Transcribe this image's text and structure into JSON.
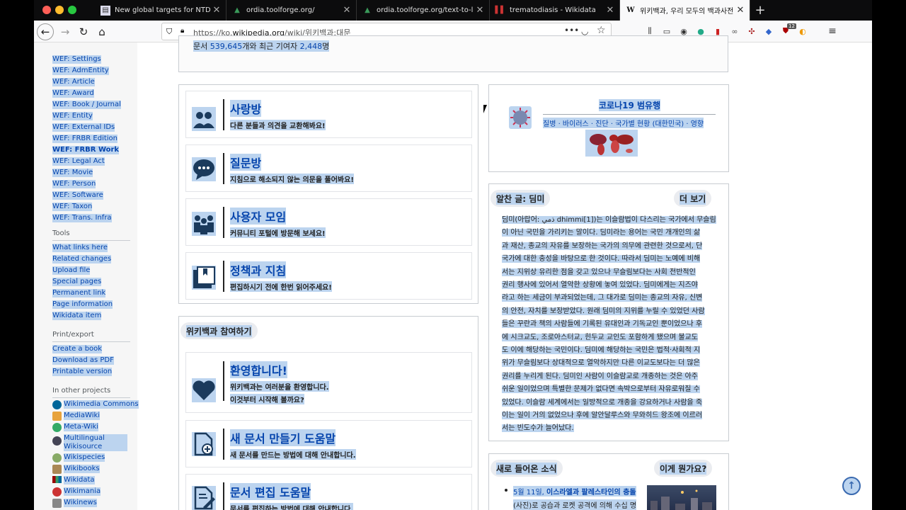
{
  "browser": {
    "tabs": [
      {
        "title": "New global targets for NTDs in",
        "favicon": "doc-icon"
      },
      {
        "title": "ordia.toolforge.org/",
        "favicon": "ordia-icon"
      },
      {
        "title": "ordia.toolforge.org/text-to-lexe",
        "favicon": "ordia-icon"
      },
      {
        "title": "trematodiasis - Wikidata",
        "favicon": "wikidata-icon"
      },
      {
        "title": "위키백과, 우리 모두의 백과사전",
        "favicon": "wikipedia-icon"
      }
    ],
    "url_prefix": "https://ko.",
    "url_domain": "wikipedia.org",
    "url_path": "/wiki/위키백과:대문",
    "ext_badge": "12"
  },
  "sidebar": {
    "wef_items": [
      "WEF: Settings",
      "WEF: AdmEntity",
      "WEF: Article",
      "WEF: Award",
      "WEF: Book / Journal",
      "WEF: Entity",
      "WEF: External IDs",
      "WEF: FRBR Edition",
      "WEF: FRBR Work",
      "WEF: Legal Act",
      "WEF: Movie",
      "WEF: Person",
      "WEF: Software",
      "WEF: Taxon",
      "WEF: Trans. Infra"
    ],
    "tools_heading": "Tools",
    "tools": [
      "What links here",
      "Related changes",
      "Upload file",
      "Special pages",
      "Permanent link",
      "Page information",
      "Wikidata item"
    ],
    "print_heading": "Print/export",
    "print": [
      "Create a book",
      "Download as PDF",
      "Printable version"
    ],
    "projects_heading": "In other projects",
    "projects": [
      "Wikimedia Commons",
      "MediaWiki",
      "Meta-Wiki",
      "Multilingual Wikisource",
      "Wikispecies",
      "Wikibooks",
      "Wikidata",
      "Wikimania",
      "Wikinews"
    ]
  },
  "stats": {
    "prefix": "문서 ",
    "articles": "539,645",
    "middle": "개와 최근 기여자 ",
    "contributors": "2,448",
    "suffix": "명"
  },
  "community": [
    {
      "title": "사랑방",
      "desc": "다른 분들과 의견을 교환해봐요!",
      "icon": "people-icon"
    },
    {
      "title": "질문방",
      "desc": "지침으로 해소되지 않는 의문을 풀어봐요!",
      "icon": "speech-bubble-icon"
    },
    {
      "title": "사용자 모임",
      "desc": "커뮤니티 포털에 방문해 보세요!",
      "icon": "group-icon"
    },
    {
      "title": "정책과 지침",
      "desc": "편집하시기 전에 한번 읽어주세요!",
      "icon": "book-icon"
    }
  ],
  "participate": {
    "heading": "위키백과 참여하기",
    "items": [
      {
        "title": "환영합니다!",
        "desc": "위키백과는 여러분을 환영합니다.",
        "desc2": "이것부터 시작해 볼까요?",
        "icon": "heart-icon"
      },
      {
        "title": "새 문서 만들기 도움말",
        "desc": "새 문서를 만드는 방법에 대해 안내합니다.",
        "icon": "new-document-icon"
      },
      {
        "title": "문서 편집 도움말",
        "desc": "문서를 편집하는 방법에 대해 안내합니다.",
        "icon": "edit-document-icon"
      }
    ]
  },
  "covid": {
    "title": "코로나19 범유행",
    "links": "질병 · 바이러스 · 진단 · 국가별 현황 (대한민국) · 영향"
  },
  "featured": {
    "heading": "알찬 글: 딤미",
    "more": "더 보기",
    "lines": [
      "딤미(아랍어: ذمي dhimmi[1])는 이슬람법이 다스리는 국가에서 무슬림",
      "이 아닌 국민을 가리키는 말이다. 딤미라는 용어는 국민 개개인의 삶",
      "과 재산, 종교의 자유를 보장하는 국가의 의무에 관련한 것으로서, 단",
      "국가에 대한 충성을 바탕으로 한 것이다. 따라서 딤미는 노예에 비해",
      "서는 지위상 유리한 점을 갖고 있으나 무슬림보다는 사회 전반적인",
      "권리 행사에 있어서 열악한 상황에 놓여 있었다. 딤미에게는 지즈야",
      "라고 하는 세금이 부과되었는데, 그 대가로 딤미는 종교의 자유, 신변",
      "의 안전, 자치를 보장받았다. 원래 딤미의 지위를 누릴 수 있었던 사람",
      "들은 꾸란과 책의 사람들에 기록된 유대인과 기독교인 뿐이었으나 후",
      "에 시크교도, 조로아스터교, 힌두교 교인도 포함하게 됐으며 불교도",
      "도 이에 해당하는 국민이다. 딤미에 해당하는 국민은 법적·사회적 지",
      "위가 무슬림보다 상대적으로 열악하지만 다른 이교도보다는 더 많은",
      "권리를 누리게 된다. 딤미인 사람이 이슬람교로 개종하는 것은 아주",
      "쉬운 일이었으며 특별한 문제가 없다면 속박으로부터 자유로워질 수",
      "있었다. 이슬람 세계에서는 일방적으로 개종을 강요하거나 사람을 죽",
      "이는 일이 거의 없었으나 후에 알안달루스와 무와히드 왕조에 이르러",
      "서는 빈도수가 늘어났다."
    ]
  },
  "news": {
    "heading": "새로 들어온 소식",
    "more": "이게 뭔가요?",
    "line1_date": "5월 11일, ",
    "line1_bold": "이스라엘과 팔레스타인의 충돌",
    "line2": "(사진)로 공습과 로켓 공격에 의해 수십 명"
  }
}
